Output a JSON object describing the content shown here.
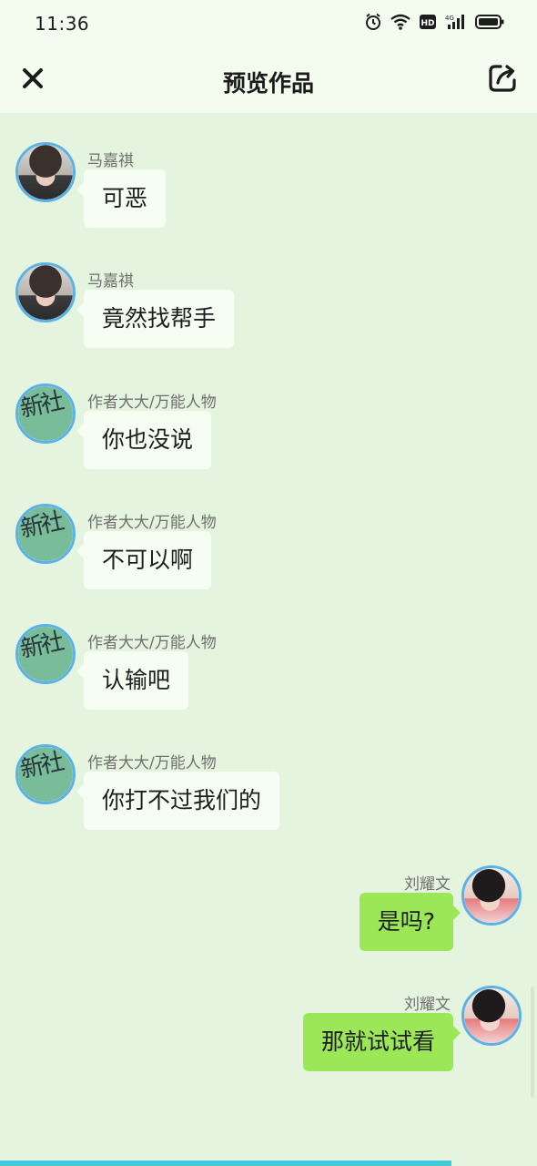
{
  "status_bar": {
    "time": "11:36",
    "icons": [
      "alarm-icon",
      "wifi-icon",
      "hd-icon",
      "4g-signal-icon",
      "battery-icon"
    ],
    "hd_label": "HD",
    "net_label": "4G"
  },
  "header": {
    "title": "预览作品",
    "close_icon": "close-icon",
    "share_icon": "share-icon"
  },
  "messages": [
    {
      "side": "left",
      "sender": "马嘉祺",
      "text": "可恶",
      "avatar": "boy-a"
    },
    {
      "side": "left",
      "sender": "马嘉祺",
      "text": "竟然找帮手",
      "avatar": "boy-a"
    },
    {
      "side": "left",
      "sender": "作者大大/万能人物",
      "text": "你也没说",
      "avatar": "author"
    },
    {
      "side": "left",
      "sender": "作者大大/万能人物",
      "text": "不可以啊",
      "avatar": "author"
    },
    {
      "side": "left",
      "sender": "作者大大/万能人物",
      "text": "认输吧",
      "avatar": "author"
    },
    {
      "side": "left",
      "sender": "作者大大/万能人物",
      "text": "你打不过我们的",
      "avatar": "author"
    },
    {
      "side": "right",
      "sender": "刘耀文",
      "text": "是吗?",
      "avatar": "boy-b"
    },
    {
      "side": "right",
      "sender": "刘耀文",
      "text": "那就试试看",
      "avatar": "boy-b"
    }
  ],
  "author_avatar_text": "新社",
  "colors": {
    "background": "#e5f4de",
    "header": "#f3fcef",
    "left_bubble": "#f6fdf2",
    "right_bubble": "#9be758",
    "avatar_ring": "#5ab2e6",
    "progress": "#41c9d8"
  },
  "progress": 0.84
}
